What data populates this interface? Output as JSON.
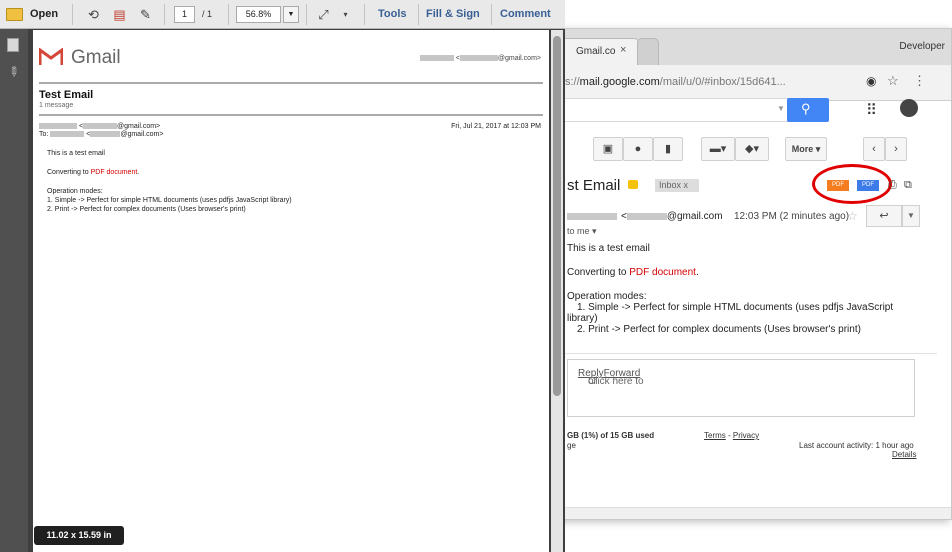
{
  "chrome": {
    "tab_title": "Gmail.co",
    "tab_close": "×",
    "developer_label": "Developer",
    "url_prefix": "s://",
    "url_host": "mail.google.com",
    "url_path": "/mail/u/0/#inbox/15d641...",
    "icons": [
      "eye-icon",
      "star-icon",
      "menu-icon",
      "search-icon",
      "apps-icon",
      "account-icon"
    ]
  },
  "gmail": {
    "toolbar": {
      "more_label": "More",
      "icons": [
        "back-icon",
        "archive-icon",
        "report-spam-icon",
        "delete-icon",
        "move-to-icon",
        "labels-icon",
        "prev-icon",
        "next-icon"
      ]
    },
    "subject": "st Email",
    "inbox_chip": "Inbox  x",
    "pdf_button_1": "PDF",
    "pdf_button_2": "PDF",
    "sender_domain": "@gmail.com",
    "time": "12:03 PM (2 minutes ago)",
    "to_me": "to me",
    "body": {
      "line1": "This is a test email",
      "line2_prefix": "Converting to ",
      "line2_red": "PDF document",
      "line2_suffix": ".",
      "line3": "Operation modes:",
      "line4": "1. Simple -> Perfect for simple HTML documents (uses pdfjs JavaScript",
      "line5": "library)",
      "line6": "2. Print -> Perfect for complex documents (Uses browser's print)"
    },
    "reply_box": {
      "prefix": "Click here to ",
      "reply": "Reply",
      "or": " or ",
      "forward": "Forward"
    },
    "footer": {
      "storage": "GB (1%) of 15 GB used",
      "storage2": "ge",
      "terms": "Terms",
      "dash": " - ",
      "privacy": "Privacy",
      "activity": "Last account activity: 1 hour ago",
      "details": "Details"
    }
  },
  "acrobat": {
    "toolbar": {
      "open_label": "Open",
      "page_current": "1",
      "page_total": "/ 1",
      "zoom": "56.8%",
      "tools": "Tools",
      "fill_sign": "Fill & Sign",
      "comment": "Comment"
    },
    "size_badge": "11.02 x 15.59 in"
  },
  "pdf": {
    "brand": "Gmail",
    "header_email_suffix": "@gmail.com>",
    "title": "Test Email",
    "message_count": "1 message",
    "from_suffix": "@gmail.com>",
    "to_prefix": "To: ",
    "to_suffix": "@gmail.com>",
    "date": "Fri, Jul 21, 2017 at 12:03 PM",
    "body": {
      "line1": "This is a test email",
      "line2_prefix": "Converting to ",
      "line2_red": "PDF document",
      "line2_suffix": ".",
      "line3": "Operation modes:",
      "line4": "1. Simple -> Perfect for simple HTML documents (uses pdfjs JavaScript library)",
      "line5": "2. Print -> Perfect for complex documents (Uses browser's print)"
    },
    "colors": {
      "gmail_red": "#d44638",
      "link_red": "#d50000"
    }
  }
}
